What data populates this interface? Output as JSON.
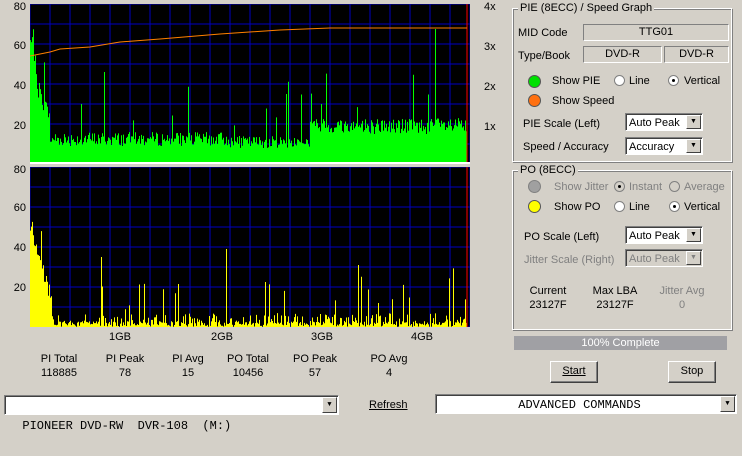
{
  "pie_graph": {
    "y_ticks": [
      "80",
      "60",
      "40",
      "20"
    ],
    "speed_ticks": [
      "4x",
      "3x",
      "2x",
      "1x"
    ],
    "colors": {
      "bars": "#00ff00",
      "speed": "#ff8000",
      "grid": "#0000c0",
      "bg": "#000000",
      "end_marker": "#ff0000"
    }
  },
  "po_graph": {
    "y_ticks": [
      "80",
      "60",
      "40",
      "20"
    ],
    "colors": {
      "bars": "#ffff00",
      "grid": "#0000c0",
      "bg": "#000000"
    }
  },
  "x_axis": [
    "1GB",
    "2GB",
    "3GB",
    "4GB"
  ],
  "stats": [
    {
      "label": "PI Total",
      "value": "118885"
    },
    {
      "label": "PI Peak",
      "value": "78"
    },
    {
      "label": "PI Avg",
      "value": "15"
    },
    {
      "label": "PO Total",
      "value": "10456"
    },
    {
      "label": "PO Peak",
      "value": "57"
    },
    {
      "label": "PO Avg",
      "value": "4"
    }
  ],
  "pie_panel": {
    "title": "PIE (8ECC) / Speed Graph",
    "mid_code_label": "MID Code",
    "mid_code": "TTG01",
    "type_book_label": "Type/Book",
    "type": "DVD-R",
    "book": "DVD-R",
    "show_pie": "Show PIE",
    "line": "Line",
    "vertical": "Vertical",
    "show_speed": "Show Speed",
    "scale_label": "PIE Scale (Left)",
    "scale_value": "Auto Peak",
    "speed_accuracy_label": "Speed / Accuracy",
    "speed_accuracy_value": "Accuracy"
  },
  "po_panel": {
    "title": "PO (8ECC)",
    "show_jitter": "Show Jitter",
    "instant": "Instant",
    "average": "Average",
    "show_po": "Show PO",
    "line": "Line",
    "vertical": "Vertical",
    "scale_label": "PO Scale (Left)",
    "scale_value": "Auto Peak",
    "jitter_scale_label": "Jitter Scale (Right)",
    "jitter_scale_value": "Auto Peak",
    "current_label": "Current",
    "current_value": "23127F",
    "maxlba_label": "Max LBA",
    "maxlba_value": "23127F",
    "jitter_avg_label": "Jitter Avg",
    "jitter_avg_value": "0"
  },
  "progress_text": "100% Complete",
  "buttons": {
    "start": "Start",
    "stop": "Stop"
  },
  "drive": "PIONEER DVD-RW  DVR-108  (M:)",
  "refresh": "Refresh",
  "commands": "ADVANCED COMMANDS"
}
